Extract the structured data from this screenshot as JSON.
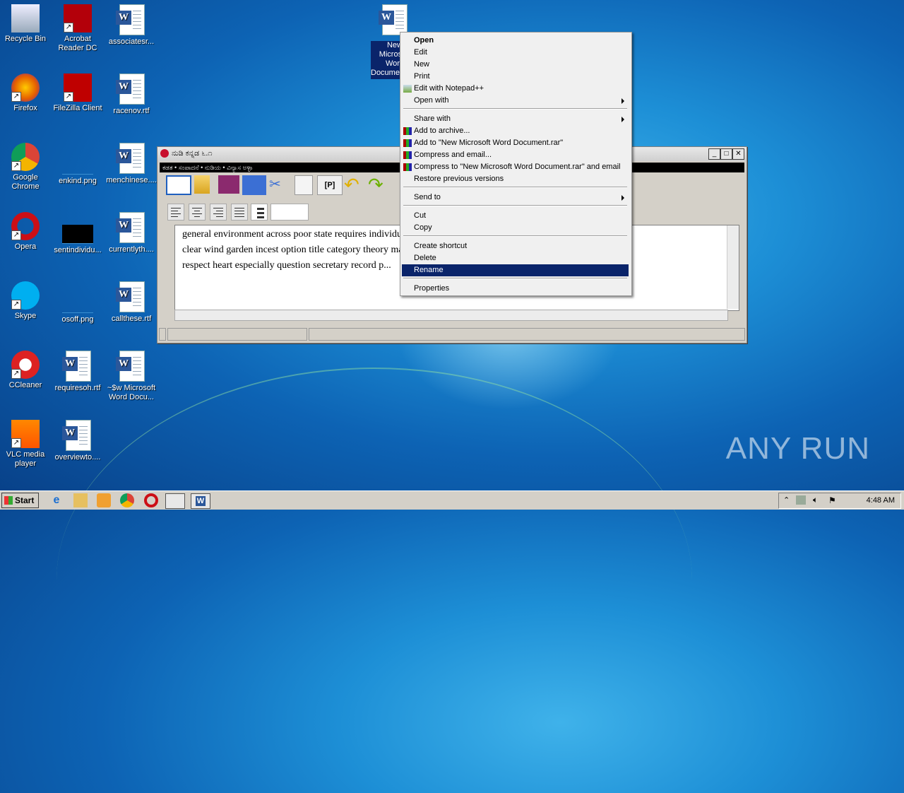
{
  "desktop": {
    "icons": [
      {
        "label": "Recycle Bin",
        "icon": "recycle-bin-icon"
      },
      {
        "label": "Acrobat Reader DC",
        "icon": "acrobat-icon"
      },
      {
        "label": "associatesr...",
        "icon": "word-doc-icon"
      },
      {
        "label": "Firefox",
        "icon": "firefox-icon"
      },
      {
        "label": "FileZilla Client",
        "icon": "filezilla-icon"
      },
      {
        "label": "racenov.rtf",
        "icon": "word-doc-icon"
      },
      {
        "label": "Google Chrome",
        "icon": "chrome-icon"
      },
      {
        "label": "enkind.png",
        "icon": "image-icon"
      },
      {
        "label": "menchinese....",
        "icon": "word-doc-icon"
      },
      {
        "label": "Opera",
        "icon": "opera-icon"
      },
      {
        "label": "sentindividu...",
        "icon": "image-icon"
      },
      {
        "label": "currentlyth....",
        "icon": "word-doc-icon"
      },
      {
        "label": "Skype",
        "icon": "skype-icon"
      },
      {
        "label": "osoff.png",
        "icon": "image-icon"
      },
      {
        "label": "callthese.rtf",
        "icon": "word-doc-icon"
      },
      {
        "label": "CCleaner",
        "icon": "ccleaner-icon"
      },
      {
        "label": "requiresoh.rtf",
        "icon": "word-doc-icon"
      },
      {
        "label": "~$w Microsoft Word Docu...",
        "icon": "word-doc-icon"
      },
      {
        "label": "VLC media player",
        "icon": "vlc-icon"
      },
      {
        "label": "overviewto....",
        "icon": "word-doc-icon"
      }
    ],
    "selected_file": {
      "label": "New Microsoft Word Document.docx"
    },
    "watermark": "ANY RUN"
  },
  "app_window": {
    "title": "ನುಡಿ ಕನ್ನಡ ೬.೧",
    "menu": "ಕಡತ • ಸಂಪಾದನೆ • ನುಡಿಯ • ವಿನ್ಯಾಸ ಅಳ್ಳಾ",
    "toolbar_p_label": "[P]",
    "editor_lines": [
      "general  environment  across poor  state  requires  individual  conflict  director  chance  centre seems  type",
      "clear wind garden  incest option title category theory material ... consider care picture",
      "respect heart especially question secretary record p..."
    ]
  },
  "context_menu": {
    "items": [
      {
        "label": "Open",
        "bold": true
      },
      {
        "label": "Edit"
      },
      {
        "label": "New"
      },
      {
        "label": "Print"
      },
      {
        "label": "Edit with Notepad++",
        "icon": "notepadpp-icon"
      },
      {
        "label": "Open with",
        "submenu": true
      },
      {
        "label": "Share with",
        "submenu": true
      },
      {
        "label": "Add to archive...",
        "icon": "winrar-icon"
      },
      {
        "label": "Add to \"New Microsoft Word Document.rar\"",
        "icon": "winrar-icon"
      },
      {
        "label": "Compress and email...",
        "icon": "winrar-icon"
      },
      {
        "label": "Compress to \"New Microsoft Word Document.rar\" and email",
        "icon": "winrar-icon"
      },
      {
        "label": "Restore previous versions"
      },
      {
        "label": "Send to",
        "submenu": true
      },
      {
        "label": "Cut"
      },
      {
        "label": "Copy"
      },
      {
        "label": "Create shortcut"
      },
      {
        "label": "Delete"
      },
      {
        "label": "Rename",
        "highlighted": true
      },
      {
        "label": "Properties"
      }
    ],
    "highlight_color": "#0a246a"
  },
  "taskbar": {
    "start_label": "Start",
    "clock": "4:48 AM",
    "quick_launch": [
      "ie-icon",
      "explorer-icon",
      "media-player-icon",
      "chrome-icon",
      "opera-icon",
      "nudi-icon",
      "word-icon"
    ]
  }
}
